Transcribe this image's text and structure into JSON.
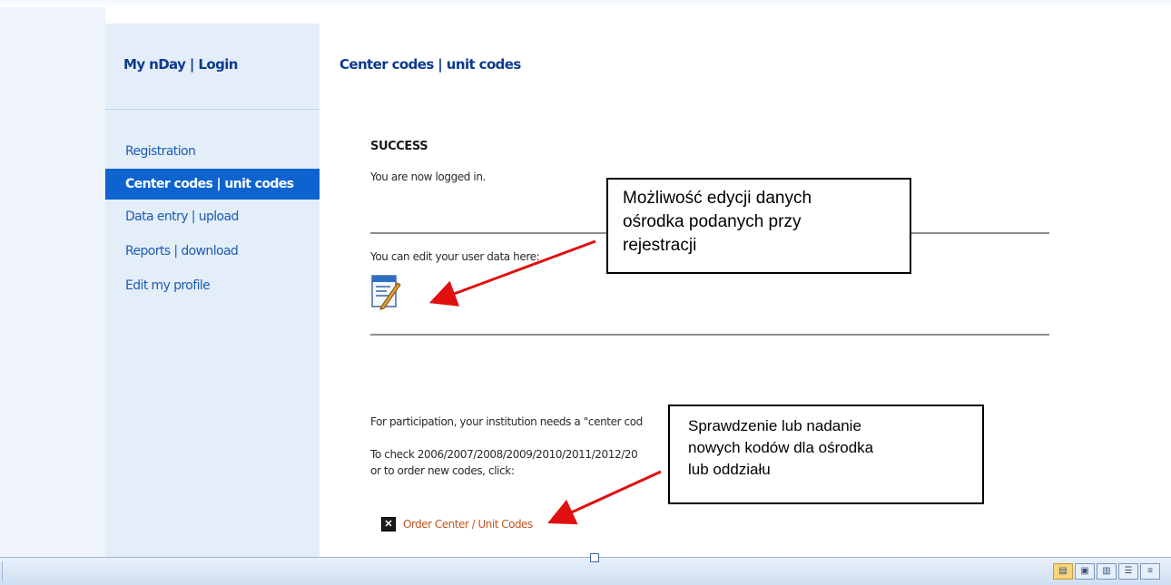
{
  "sidebar": {
    "title": "My nDay | Login",
    "items": [
      {
        "label": "Registration",
        "active": false
      },
      {
        "label": "Center codes | unit codes",
        "active": true
      },
      {
        "label": "Data entry | upload",
        "active": false
      },
      {
        "label": "Reports | download",
        "active": false
      },
      {
        "label": "Edit my profile",
        "active": false
      }
    ]
  },
  "main": {
    "breadcrumb": "Center codes | unit codes",
    "success_title": "SUCCESS",
    "logged_in_text": "You are now logged in.",
    "edit_user_text": "You can edit your user data here:",
    "participation_text": "For participation, your institution needs a \"center cod",
    "check_codes_text": "To check 2006/2007/2008/2009/2010/2011/2012/20",
    "order_new_text": "or to order new codes, click:",
    "order_link": "Order Center / Unit Codes",
    "edit_icon": "edit-document-icon",
    "order_icon": "x-box-icon"
  },
  "callouts": [
    {
      "lines": [
        "Możliwość edycji danych",
        "ośrodka podanych przy",
        "rejestracji"
      ]
    },
    {
      "lines": [
        "Sprawdzenie lub nadanie",
        "nowych kodów dla ośrodka",
        "lub oddziału"
      ]
    }
  ],
  "colors": {
    "nav_active_bg": "#0d64d0",
    "link_blue": "#1c5bb4",
    "heading_blue": "#0e3a8f",
    "order_link": "#c0561e",
    "arrow_red": "#e01010"
  },
  "statusbar": {
    "view_buttons": [
      "print-layout-icon",
      "full-screen-icon",
      "web-layout-icon",
      "outline-icon",
      "draft-icon"
    ]
  }
}
